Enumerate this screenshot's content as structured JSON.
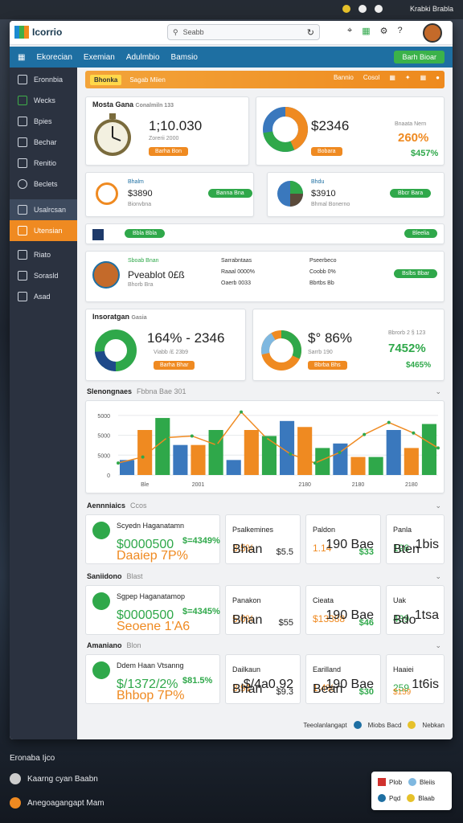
{
  "os": {
    "status": "Krabki Brabla"
  },
  "app": {
    "logo": "Icorrio"
  },
  "search": {
    "placeholder": "Seabb"
  },
  "nav": {
    "items": [
      "Ekorecian",
      "Exemian",
      "Adulmbio",
      "Bamsio"
    ],
    "cta": "Barh Bioar"
  },
  "sidebar": {
    "items": [
      "Eronnbia",
      "Wecks",
      "Bpies",
      "Bechar",
      "Renitio",
      "Beclets",
      "Usalrcsan",
      "Utensian",
      "Riato",
      "Sorasld",
      "Asad"
    ]
  },
  "strip": {
    "badge": "Bhonka",
    "title": "Sagab Miien",
    "r1": "Bannio",
    "r2": "Cosol"
  },
  "row1": {
    "c1": {
      "title": "Mosta Gana",
      "sub": "Conalmiln 133",
      "value": "1;10.030",
      "pill": "Barha Bon"
    },
    "c2": {
      "value": "$2346",
      "sub": "Bnaata Nern",
      "value2": "260%",
      "value3": "$457%",
      "pill": "Bobara"
    }
  },
  "row2": {
    "c1": {
      "label": "Bhalm",
      "value": "$3890",
      "sub": "Bionvbna",
      "btn": "Banna Bna"
    },
    "c2": {
      "label": "Bhdu",
      "value": "$3910",
      "sub": "Bhmal Bonerno",
      "btn": "Bbcr Bara"
    }
  },
  "row3": {
    "pill": "Bbla Bbla",
    "btn": "Bleelia"
  },
  "row4": {
    "label": "Sboab Bnan",
    "value": "Pveablot 0£ß",
    "sub": "Bhorb Bra",
    "m1": "Sarrabntaas",
    "m2": "Raaal 0000%",
    "m3": "Oaerb 0033",
    "n1": "Pseerbeco",
    "n2": "Coobb 0%",
    "n3": "Bbrtbs Bb",
    "btn": "Bslbs Bbar"
  },
  "row5": {
    "title": "Insoratgan",
    "sub": "Gasia",
    "c1": {
      "value": "164% - 2346",
      "sub": "Viabb /£ 23b9",
      "pill": "Barha Bhar"
    },
    "c2": {
      "value": "$° 86%",
      "sub": "Sarrb 190",
      "value2": "7452%",
      "value3": "$465%",
      "note": "Bbrorb 2 § 123",
      "pill": "Bbrba Bhs"
    }
  },
  "chart_section": {
    "title": "Slenongnaes",
    "sub": "Fbbna Bae 301"
  },
  "chart_data": {
    "type": "bar",
    "categories": [
      "Ble",
      "2001",
      "",
      "2180",
      "2180",
      "2180"
    ],
    "x": [
      "Ble",
      "2001",
      "",
      "2180",
      "2180",
      "2180"
    ],
    "series": [
      {
        "name": "",
        "values": [
          10,
          30,
          38,
          20,
          20,
          30,
          10,
          30,
          26,
          36,
          32,
          18,
          21,
          12,
          12,
          30,
          18,
          34
        ],
        "color": "#3a78bd"
      }
    ],
    "line": [
      8,
      12,
      25,
      26,
      20,
      42,
      25,
      14,
      8,
      15,
      27,
      35,
      28,
      18
    ],
    "yticks": [
      "0",
      "5000",
      "5000",
      "5000"
    ],
    "ylim": [
      0,
      45
    ]
  },
  "sections": [
    {
      "title": "Aennniaics",
      "sub": "Ccos",
      "mc": {
        "title": "Scyedn Haganatamn",
        "line1": "$0000500",
        "line2": "Daaiep 7P%",
        "val": "$=4349%"
      },
      "m1": {
        "title": "Psalkemines",
        "val": "3.5%",
        "foot": "Bhan",
        "val2": "$5.5"
      },
      "m2": {
        "title": "Paldon",
        "val": "1.14",
        "note": "190 Bae",
        "val2": "$33"
      },
      "m3": {
        "title": "Panla",
        "val": "196",
        "note": "1bis",
        "foot": "Bten"
      }
    },
    {
      "title": "Saniidono",
      "sub": "Blast",
      "mc": {
        "title": "Sgpep Haganatamop",
        "line1": "$0000500",
        "line2": "Seoene 1'A6",
        "val": "$=4345%"
      },
      "m1": {
        "title": "Panakon",
        "val": "5.0%",
        "foot": "Bhan",
        "val2": "$55"
      },
      "m2": {
        "title": "Cieata",
        "val": "$13388",
        "note": "190 Bae",
        "val2": "$46"
      },
      "m3": {
        "title": "Uak",
        "val": "439",
        "note": "1tsa",
        "foot": "Bdo"
      }
    },
    {
      "title": "Amaniano",
      "sub": "Blon",
      "mc": {
        "title": "Ddem Haan Vtsanng",
        "line1": "$/1372/2%",
        "line2": "Bhbop 7P%",
        "val": "$81.5%"
      },
      "m1": {
        "title": "Dailkaun",
        "val": "3.91",
        "note": "$/4a0.92",
        "foot": "Bhan",
        "val2": "$9.3"
      },
      "m2": {
        "title": "Earilland",
        "val": "1.4%",
        "note": "190 Bae",
        "foot": "Bean",
        "val2": "$30"
      },
      "m3": {
        "title": "Haaiei",
        "val": "259",
        "note": "1t6is",
        "val2": "$159"
      }
    }
  ],
  "footer": {
    "left": "Teeolanlangapt",
    "mid": "Miobs Bacd",
    "right": "Nebkan"
  },
  "bottom": {
    "title": "Eronaba Ijco",
    "item1": "Kaarng cyan Baabn",
    "item2": "Anegoagangapt Mam"
  },
  "popup": {
    "r1a": "Plob",
    "r1b": "Bleiis",
    "r2a": "Pqd",
    "r2b": "Blaab"
  }
}
